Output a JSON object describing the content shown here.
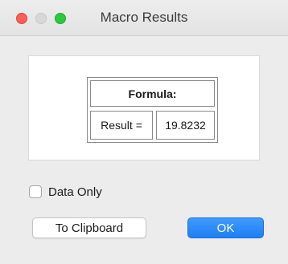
{
  "window": {
    "title": "Macro Results"
  },
  "formula_table": {
    "header": "Formula:",
    "result_label": "Result =",
    "result_value": "19.8232"
  },
  "options": {
    "data_only_label": "Data Only",
    "data_only_checked": false
  },
  "buttons": {
    "clipboard_label": "To Clipboard",
    "ok_label": "OK"
  },
  "colors": {
    "close": "#fe5f57",
    "minimize": "#d8d8d8",
    "zoom": "#2ac940",
    "default_button": "#1f7ef2"
  }
}
